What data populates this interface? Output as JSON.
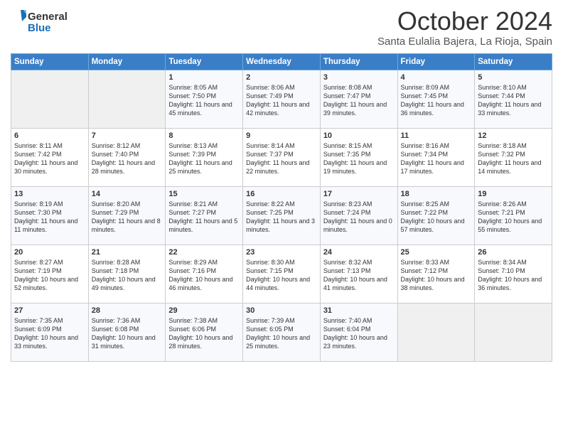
{
  "header": {
    "logo_line1": "General",
    "logo_line2": "Blue",
    "month": "October 2024",
    "location": "Santa Eulalia Bajera, La Rioja, Spain"
  },
  "days_of_week": [
    "Sunday",
    "Monday",
    "Tuesday",
    "Wednesday",
    "Thursday",
    "Friday",
    "Saturday"
  ],
  "weeks": [
    [
      {
        "day": "",
        "content": ""
      },
      {
        "day": "",
        "content": ""
      },
      {
        "day": "1",
        "content": "Sunrise: 8:05 AM\nSunset: 7:50 PM\nDaylight: 11 hours and 45 minutes."
      },
      {
        "day": "2",
        "content": "Sunrise: 8:06 AM\nSunset: 7:49 PM\nDaylight: 11 hours and 42 minutes."
      },
      {
        "day": "3",
        "content": "Sunrise: 8:08 AM\nSunset: 7:47 PM\nDaylight: 11 hours and 39 minutes."
      },
      {
        "day": "4",
        "content": "Sunrise: 8:09 AM\nSunset: 7:45 PM\nDaylight: 11 hours and 36 minutes."
      },
      {
        "day": "5",
        "content": "Sunrise: 8:10 AM\nSunset: 7:44 PM\nDaylight: 11 hours and 33 minutes."
      }
    ],
    [
      {
        "day": "6",
        "content": "Sunrise: 8:11 AM\nSunset: 7:42 PM\nDaylight: 11 hours and 30 minutes."
      },
      {
        "day": "7",
        "content": "Sunrise: 8:12 AM\nSunset: 7:40 PM\nDaylight: 11 hours and 28 minutes."
      },
      {
        "day": "8",
        "content": "Sunrise: 8:13 AM\nSunset: 7:39 PM\nDaylight: 11 hours and 25 minutes."
      },
      {
        "day": "9",
        "content": "Sunrise: 8:14 AM\nSunset: 7:37 PM\nDaylight: 11 hours and 22 minutes."
      },
      {
        "day": "10",
        "content": "Sunrise: 8:15 AM\nSunset: 7:35 PM\nDaylight: 11 hours and 19 minutes."
      },
      {
        "day": "11",
        "content": "Sunrise: 8:16 AM\nSunset: 7:34 PM\nDaylight: 11 hours and 17 minutes."
      },
      {
        "day": "12",
        "content": "Sunrise: 8:18 AM\nSunset: 7:32 PM\nDaylight: 11 hours and 14 minutes."
      }
    ],
    [
      {
        "day": "13",
        "content": "Sunrise: 8:19 AM\nSunset: 7:30 PM\nDaylight: 11 hours and 11 minutes."
      },
      {
        "day": "14",
        "content": "Sunrise: 8:20 AM\nSunset: 7:29 PM\nDaylight: 11 hours and 8 minutes."
      },
      {
        "day": "15",
        "content": "Sunrise: 8:21 AM\nSunset: 7:27 PM\nDaylight: 11 hours and 5 minutes."
      },
      {
        "day": "16",
        "content": "Sunrise: 8:22 AM\nSunset: 7:25 PM\nDaylight: 11 hours and 3 minutes."
      },
      {
        "day": "17",
        "content": "Sunrise: 8:23 AM\nSunset: 7:24 PM\nDaylight: 11 hours and 0 minutes."
      },
      {
        "day": "18",
        "content": "Sunrise: 8:25 AM\nSunset: 7:22 PM\nDaylight: 10 hours and 57 minutes."
      },
      {
        "day": "19",
        "content": "Sunrise: 8:26 AM\nSunset: 7:21 PM\nDaylight: 10 hours and 55 minutes."
      }
    ],
    [
      {
        "day": "20",
        "content": "Sunrise: 8:27 AM\nSunset: 7:19 PM\nDaylight: 10 hours and 52 minutes."
      },
      {
        "day": "21",
        "content": "Sunrise: 8:28 AM\nSunset: 7:18 PM\nDaylight: 10 hours and 49 minutes."
      },
      {
        "day": "22",
        "content": "Sunrise: 8:29 AM\nSunset: 7:16 PM\nDaylight: 10 hours and 46 minutes."
      },
      {
        "day": "23",
        "content": "Sunrise: 8:30 AM\nSunset: 7:15 PM\nDaylight: 10 hours and 44 minutes."
      },
      {
        "day": "24",
        "content": "Sunrise: 8:32 AM\nSunset: 7:13 PM\nDaylight: 10 hours and 41 minutes."
      },
      {
        "day": "25",
        "content": "Sunrise: 8:33 AM\nSunset: 7:12 PM\nDaylight: 10 hours and 38 minutes."
      },
      {
        "day": "26",
        "content": "Sunrise: 8:34 AM\nSunset: 7:10 PM\nDaylight: 10 hours and 36 minutes."
      }
    ],
    [
      {
        "day": "27",
        "content": "Sunrise: 7:35 AM\nSunset: 6:09 PM\nDaylight: 10 hours and 33 minutes."
      },
      {
        "day": "28",
        "content": "Sunrise: 7:36 AM\nSunset: 6:08 PM\nDaylight: 10 hours and 31 minutes."
      },
      {
        "day": "29",
        "content": "Sunrise: 7:38 AM\nSunset: 6:06 PM\nDaylight: 10 hours and 28 minutes."
      },
      {
        "day": "30",
        "content": "Sunrise: 7:39 AM\nSunset: 6:05 PM\nDaylight: 10 hours and 25 minutes."
      },
      {
        "day": "31",
        "content": "Sunrise: 7:40 AM\nSunset: 6:04 PM\nDaylight: 10 hours and 23 minutes."
      },
      {
        "day": "",
        "content": ""
      },
      {
        "day": "",
        "content": ""
      }
    ]
  ]
}
